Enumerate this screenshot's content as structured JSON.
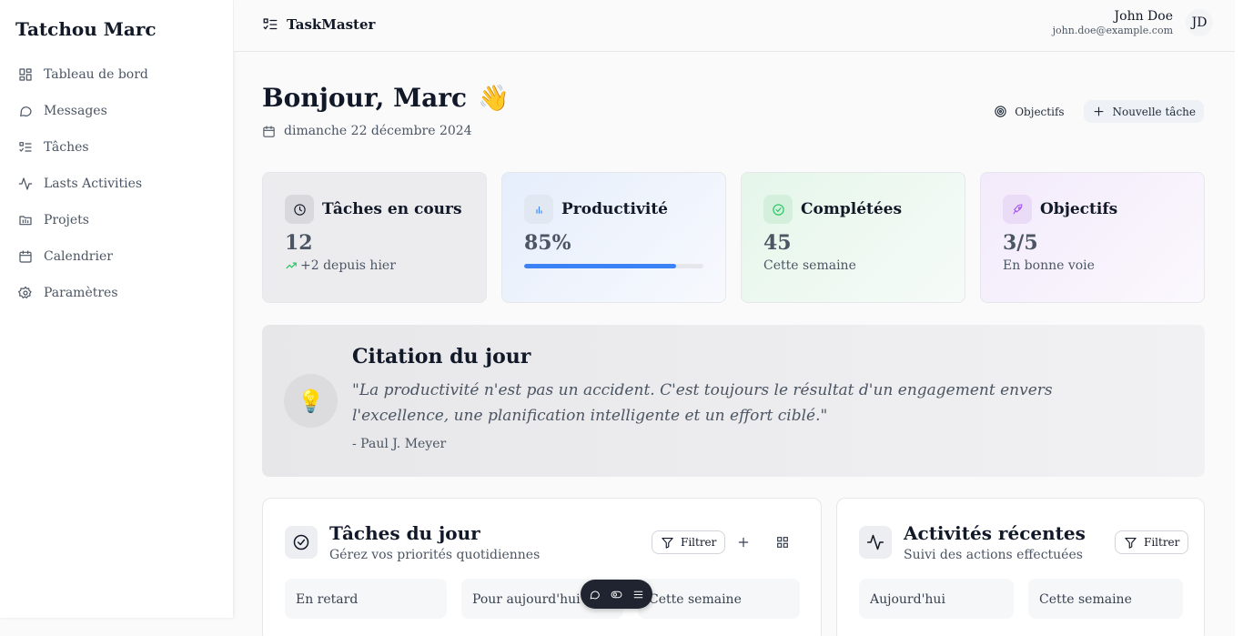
{
  "sidebar": {
    "brand": "Tatchou Marc",
    "items": [
      {
        "label": "Tableau de bord",
        "icon": "dashboard-icon"
      },
      {
        "label": "Messages",
        "icon": "message-icon"
      },
      {
        "label": "Tâches",
        "icon": "task-list-icon"
      },
      {
        "label": "Lasts Activities",
        "icon": "activity-icon"
      },
      {
        "label": "Projets",
        "icon": "folder-icon"
      },
      {
        "label": "Calendrier",
        "icon": "calendar-icon"
      },
      {
        "label": "Paramètres",
        "icon": "settings-icon"
      }
    ]
  },
  "header": {
    "app_name": "TaskMaster",
    "user_name": "John Doe",
    "user_email": "john.doe@example.com",
    "avatar_initials": "JD"
  },
  "main": {
    "greeting": "Bonjour, Marc",
    "greeting_emoji": "👋",
    "date": "dimanche 22 décembre 2024",
    "actions": {
      "objectives_label": "Objectifs",
      "new_task_label": "Nouvelle tâche"
    },
    "stats": [
      {
        "title": "Tâches en cours",
        "value": "12",
        "sub": "+2 depuis hier",
        "icon": "clock-icon"
      },
      {
        "title": "Productivité",
        "value": "85%",
        "progress": 0.85,
        "icon": "bar-chart-icon",
        "accent": "#3b82f6"
      },
      {
        "title": "Complétées",
        "value": "45",
        "sub": "Cette semaine",
        "icon": "check-circle-icon",
        "accent": "#22c55e"
      },
      {
        "title": "Objectifs",
        "value": "3/5",
        "sub": "En bonne voie",
        "icon": "rocket-icon",
        "accent": "#a855f7"
      }
    ],
    "quote": {
      "title": "Citation du jour",
      "text": "\"La productivité n'est pas un accident. C'est toujours le résultat d'un engagement envers l'excellence, une planification intelligente et un effort ciblé.\"",
      "author": "- Paul J. Meyer",
      "icon": "lightbulb-icon"
    },
    "tasks_panel": {
      "title": "Tâches du jour",
      "subtitle": "Gérez vos priorités quotidiennes",
      "filter_label": "Filtrer",
      "columns": [
        "En retard",
        "Pour aujourd'hui",
        "Cette semaine"
      ]
    },
    "activity_panel": {
      "title": "Activités récentes",
      "subtitle": "Suivi des actions effectuées",
      "filter_label": "Filtrer",
      "columns": [
        "Aujourd'hui",
        "Cette semaine"
      ]
    }
  }
}
